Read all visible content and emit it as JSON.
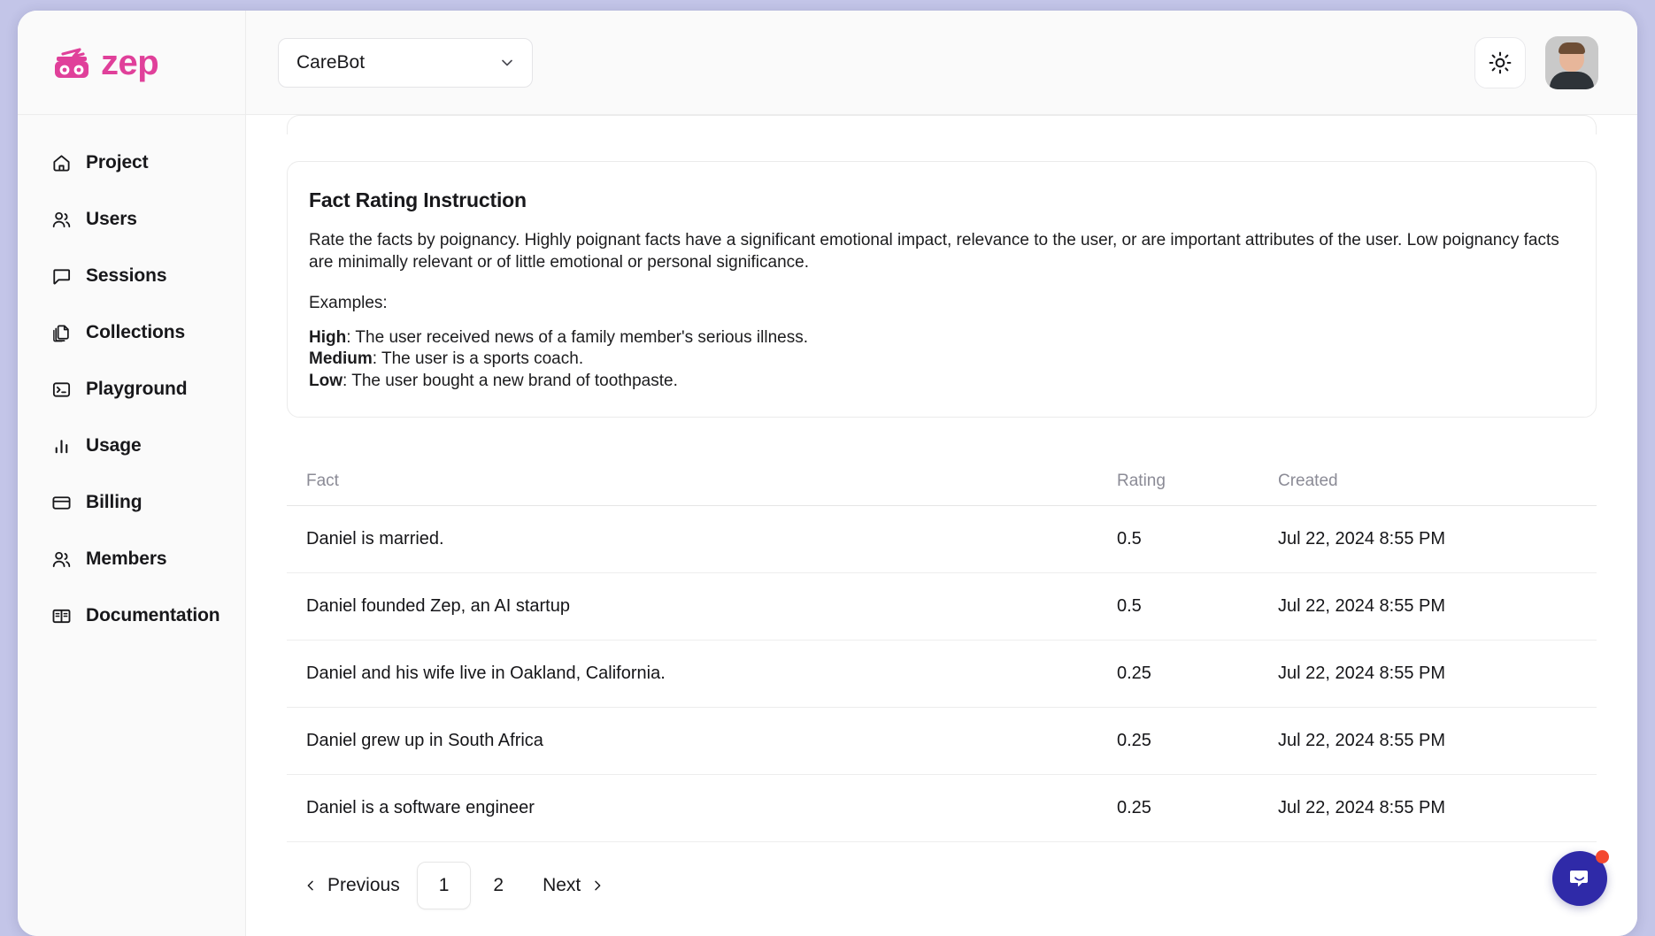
{
  "brand": {
    "word": "zep",
    "logo_icon": "zep-robot-logo",
    "color": "#e0409a"
  },
  "topbar": {
    "project_selector": {
      "value": "CareBot",
      "icon": "chevron-down-icon"
    },
    "theme_toggle": {
      "icon": "sun-icon",
      "label": "Light mode"
    },
    "avatar": {
      "icon": "user-avatar"
    }
  },
  "sidebar": {
    "items": [
      {
        "label": "Project",
        "icon": "home-icon"
      },
      {
        "label": "Users",
        "icon": "users-icon"
      },
      {
        "label": "Sessions",
        "icon": "message-square-icon"
      },
      {
        "label": "Collections",
        "icon": "copy-documents-icon"
      },
      {
        "label": "Playground",
        "icon": "terminal-icon"
      },
      {
        "label": "Usage",
        "icon": "bar-chart-icon"
      },
      {
        "label": "Billing",
        "icon": "credit-card-icon"
      },
      {
        "label": "Members",
        "icon": "users-icon"
      },
      {
        "label": "Documentation",
        "icon": "book-open-icon"
      }
    ]
  },
  "fact_rating_instruction": {
    "title": "Fact Rating Instruction",
    "paragraph": "Rate the facts by poignancy. Highly poignant facts have a significant emotional impact, relevance to the user, or are important attributes of the user. Low poignancy facts are minimally relevant or of little emotional or personal significance.",
    "examples_label": "Examples:",
    "examples": [
      {
        "level": "High",
        "text": ": The user received news of a family member's serious illness."
      },
      {
        "level": "Medium",
        "text": ": The user is a sports coach."
      },
      {
        "level": "Low",
        "text": ": The user bought a new brand of toothpaste."
      }
    ]
  },
  "facts_table": {
    "columns": [
      "Fact",
      "Rating",
      "Created"
    ],
    "rows": [
      {
        "fact": "Daniel is married.",
        "rating": "0.5",
        "created": "Jul 22, 2024 8:55 PM"
      },
      {
        "fact": "Daniel founded Zep, an AI startup",
        "rating": "0.5",
        "created": "Jul 22, 2024 8:55 PM"
      },
      {
        "fact": "Daniel and his wife live in Oakland, California.",
        "rating": "0.25",
        "created": "Jul 22, 2024 8:55 PM"
      },
      {
        "fact": "Daniel grew up in South Africa",
        "rating": "0.25",
        "created": "Jul 22, 2024 8:55 PM"
      },
      {
        "fact": "Daniel is a software engineer",
        "rating": "0.25",
        "created": "Jul 22, 2024 8:55 PM"
      }
    ]
  },
  "pagination": {
    "previous_label": "Previous",
    "next_label": "Next",
    "pages": [
      "1",
      "2"
    ],
    "active_page": "1",
    "prev_icon": "chevron-left-icon",
    "next_icon": "chevron-right-icon"
  },
  "chat_widget": {
    "icon": "intercom-chat-icon",
    "badge": "unread-dot",
    "color": "#2f2aa8"
  }
}
